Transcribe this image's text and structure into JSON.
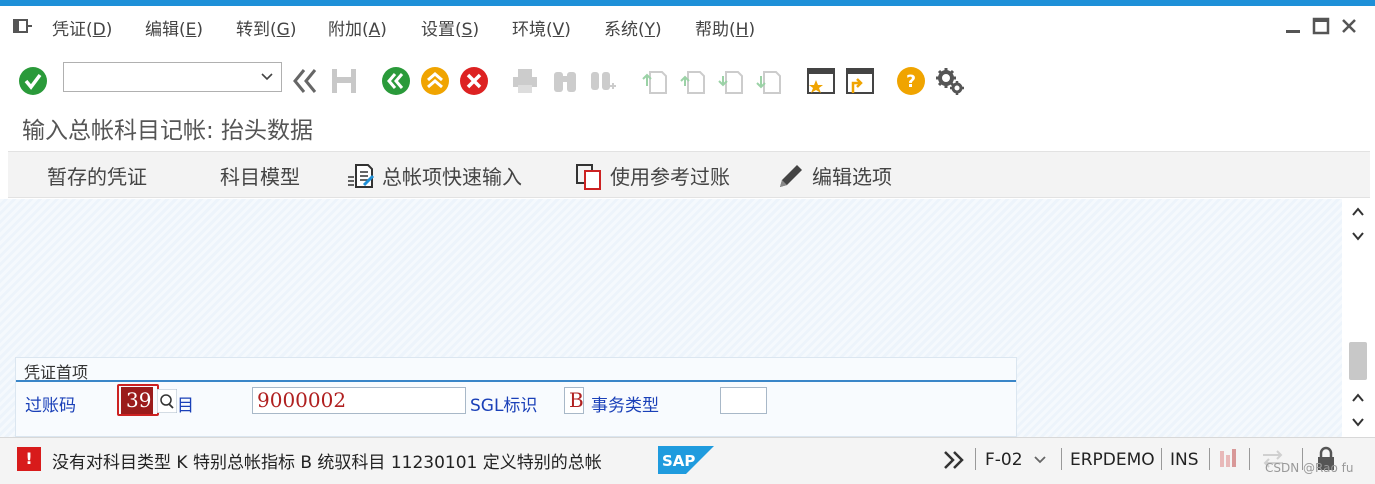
{
  "menu": {
    "items": [
      {
        "label": "凭证",
        "key": "D"
      },
      {
        "label": "编辑",
        "key": "E"
      },
      {
        "label": "转到",
        "key": "G"
      },
      {
        "label": "附加",
        "key": "A"
      },
      {
        "label": "设置",
        "key": "S"
      },
      {
        "label": "环境",
        "key": "V"
      },
      {
        "label": "系统",
        "key": "Y"
      },
      {
        "label": "帮助",
        "key": "H"
      }
    ]
  },
  "command_field": {
    "value": ""
  },
  "title": "输入总帐科目记帐: 抬头数据",
  "app_toolbar": {
    "items": [
      "暂存的凭证",
      "科目模型",
      "总帐项快速输入",
      "使用参考过账",
      "编辑选项"
    ]
  },
  "header_group": {
    "title": "凭证首项",
    "posting_key_label": "过账码",
    "posting_key_value": "39",
    "account_label": "目",
    "account_value": "9000002",
    "sgl_label": "SGL标识",
    "sgl_value": "B",
    "trans_type_label": "事务类型",
    "trans_type_value": ""
  },
  "status": {
    "icon": "!",
    "message": "没有对科目类型 K 特别总帐指标 B 统驭科目 11230101 定义特别的总帐",
    "tcode": "F-02",
    "system": "ERPDEMO",
    "mode": "INS",
    "watermark": "CSDN @Rao fu"
  },
  "colors": {
    "accent": "#1e90d8",
    "error": "#d81b1b",
    "link": "#1a40b8",
    "sap": "#1f9bde"
  }
}
